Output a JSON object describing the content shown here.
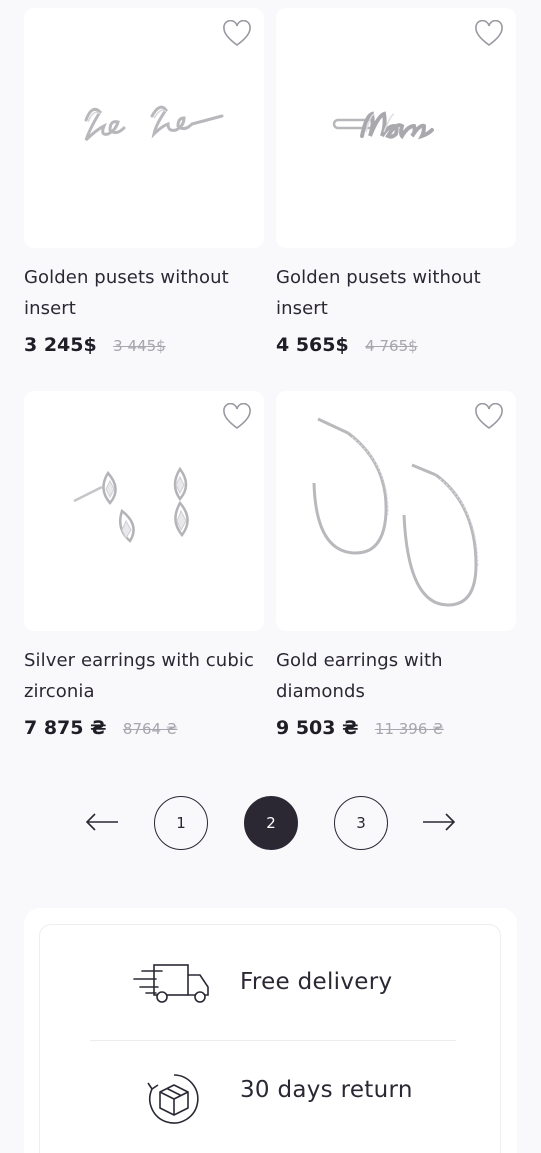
{
  "products": [
    {
      "title": "Golden pusets without insert",
      "price": "3 245$",
      "old_price": "3 445$",
      "image": "love-earrings",
      "favorite_icon": "heart-outline-icon"
    },
    {
      "title": "Golden pusets without insert",
      "price": "4 565$",
      "old_price": "4 765$",
      "image": "mom-pin",
      "favorite_icon": "heart-outline-icon"
    },
    {
      "title": "Silver earrings with cubic zirconia",
      "price": "7 875 ₴",
      "old_price": "8764 ₴",
      "image": "drop-earrings",
      "favorite_icon": "heart-outline-icon"
    },
    {
      "title": "Gold earrings with diamonds",
      "price": "9 503 ₴",
      "old_price": "11 396 ₴",
      "image": "hoop-earrings",
      "favorite_icon": "heart-outline-icon"
    }
  ],
  "pagination": {
    "prev_icon": "arrow-left-icon",
    "next_icon": "arrow-right-icon",
    "pages": [
      "1",
      "2",
      "3"
    ],
    "current": "2"
  },
  "features": [
    {
      "label": "Free delivery",
      "icon": "delivery-truck-icon"
    },
    {
      "label": "30 days return",
      "icon": "return-box-icon"
    }
  ],
  "colors": {
    "accent": "#2b2834",
    "background": "#f9f8fb",
    "card": "#ffffff",
    "old_price": "#a8a6ae"
  }
}
